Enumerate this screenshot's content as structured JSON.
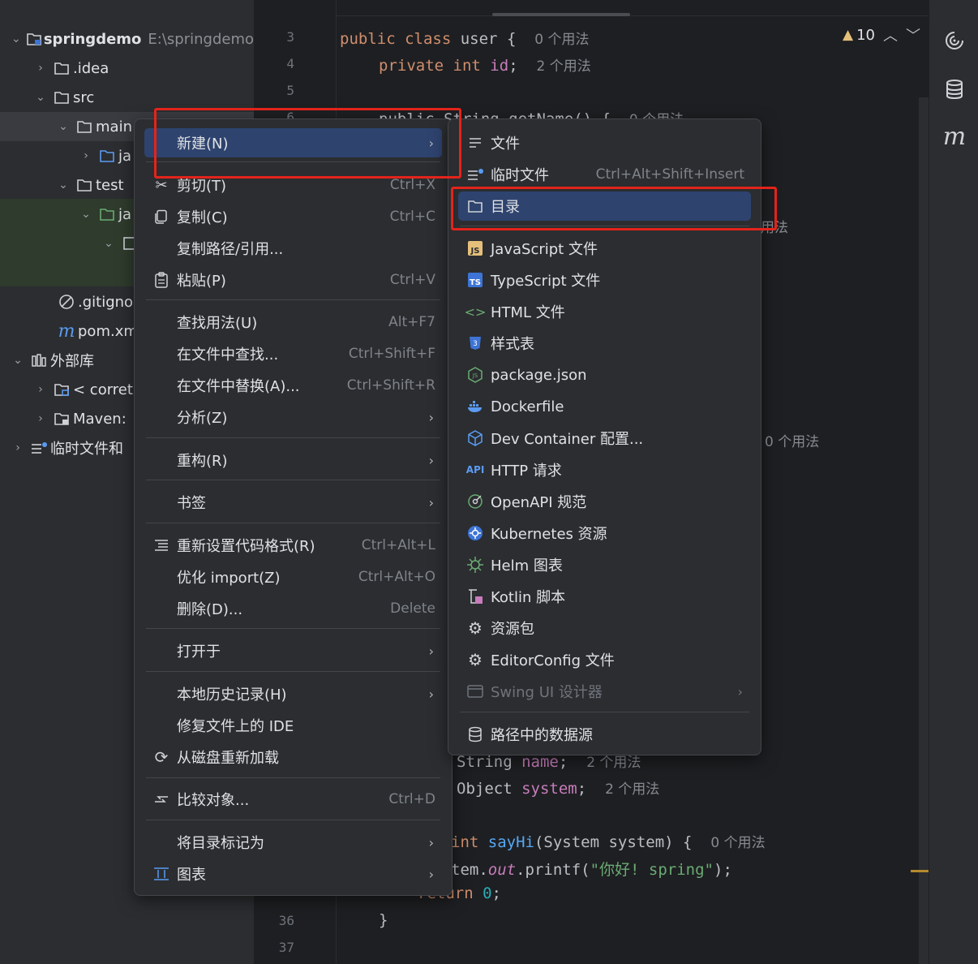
{
  "project_tree": {
    "root_name": "springdemo",
    "root_path": "E:\\springdemo",
    "items": [
      {
        "label": ".idea"
      },
      {
        "label": "src"
      },
      {
        "label": "main"
      },
      {
        "label": "ja"
      },
      {
        "label": "test"
      },
      {
        "label": "ja"
      },
      {
        "label": ""
      },
      {
        "label": ".gitigno"
      },
      {
        "label": "pom.xm"
      },
      {
        "label": "外部库"
      },
      {
        "label": "< corret"
      },
      {
        "label": "Maven:"
      },
      {
        "label": "临时文件和"
      }
    ]
  },
  "editor": {
    "line_numbers": [
      "3",
      "4",
      "5",
      "6",
      "36",
      "37"
    ],
    "line3": {
      "kw": "public class",
      "name": "user",
      "brace": "{",
      "hint": "0 个用法"
    },
    "line4": {
      "kw": "private int",
      "field": "id",
      "semi": ";",
      "hint": "2 个用法"
    },
    "line6": {
      "text": "public String getName() {",
      "hint": "0 个用法"
    },
    "partial_hint_1": "用法",
    "partial_hint_2": "0 个用法",
    "line_name": {
      "type": "String",
      "field": "name",
      "semi": ";",
      "hint": "2 个用法"
    },
    "line_system": {
      "type": "Object",
      "field": "system",
      "semi": ";",
      "hint": "2 个用法"
    },
    "line_sayhi": {
      "kw": "int",
      "fn": "sayHi",
      "params": "(System system) {",
      "hint": "0 个用法"
    },
    "line_printf": {
      "prefix": "tem.",
      "out": "out",
      "call": ".printf(",
      "str": "\"你好! spring\"",
      "end": ");"
    },
    "line_return": {
      "kw": "return",
      "num": "0",
      "semi": ";"
    },
    "line36": "}",
    "warnings": "10"
  },
  "context_menu": {
    "items": [
      {
        "label": "新建(N)",
        "shortcut": "",
        "icon": "",
        "arrow": true
      },
      {
        "label": "剪切(T)",
        "shortcut": "Ctrl+X",
        "icon": "scissors-icon"
      },
      {
        "label": "复制(C)",
        "shortcut": "Ctrl+C",
        "icon": "copy-icon"
      },
      {
        "label": "复制路径/引用...",
        "shortcut": "",
        "icon": ""
      },
      {
        "label": "粘贴(P)",
        "shortcut": "Ctrl+V",
        "icon": "paste-icon"
      },
      {
        "label": "查找用法(U)",
        "shortcut": "Alt+F7",
        "icon": ""
      },
      {
        "label": "在文件中查找...",
        "shortcut": "Ctrl+Shift+F",
        "icon": ""
      },
      {
        "label": "在文件中替换(A)...",
        "shortcut": "Ctrl+Shift+R",
        "icon": ""
      },
      {
        "label": "分析(Z)",
        "shortcut": "",
        "icon": "",
        "arrow": true
      },
      {
        "label": "重构(R)",
        "shortcut": "",
        "icon": "",
        "arrow": true
      },
      {
        "label": "书签",
        "shortcut": "",
        "icon": "",
        "arrow": true
      },
      {
        "label": "重新设置代码格式(R)",
        "shortcut": "Ctrl+Alt+L",
        "icon": "reformat-icon"
      },
      {
        "label": "优化 import(Z)",
        "shortcut": "Ctrl+Alt+O",
        "icon": ""
      },
      {
        "label": "删除(D)...",
        "shortcut": "Delete",
        "icon": ""
      },
      {
        "label": "打开于",
        "shortcut": "",
        "icon": "",
        "arrow": true
      },
      {
        "label": "本地历史记录(H)",
        "shortcut": "",
        "icon": "",
        "arrow": true
      },
      {
        "label": "修复文件上的 IDE",
        "shortcut": "",
        "icon": ""
      },
      {
        "label": "从磁盘重新加载",
        "shortcut": "",
        "icon": "reload-icon"
      },
      {
        "label": "比较对象...",
        "shortcut": "Ctrl+D",
        "icon": "compare-icon"
      },
      {
        "label": "将目录标记为",
        "shortcut": "",
        "icon": "",
        "arrow": true
      },
      {
        "label": "图表",
        "shortcut": "",
        "icon": "diagram-icon",
        "arrow": true
      }
    ]
  },
  "submenu": {
    "items": [
      {
        "label": "文件",
        "shortcut": ""
      },
      {
        "label": "临时文件",
        "shortcut": "Ctrl+Alt+Shift+Insert"
      },
      {
        "label": "目录",
        "shortcut": ""
      },
      {
        "label": "JavaScript 文件",
        "shortcut": "",
        "badge": "JS"
      },
      {
        "label": "TypeScript 文件",
        "shortcut": "",
        "badge": "TS"
      },
      {
        "label": "HTML 文件",
        "shortcut": ""
      },
      {
        "label": "样式表",
        "shortcut": ""
      },
      {
        "label": "package.json",
        "shortcut": ""
      },
      {
        "label": "Dockerfile",
        "shortcut": ""
      },
      {
        "label": "Dev Container 配置...",
        "shortcut": ""
      },
      {
        "label": "HTTP 请求",
        "shortcut": "",
        "badge": "API"
      },
      {
        "label": "OpenAPI 规范",
        "shortcut": ""
      },
      {
        "label": "Kubernetes 资源",
        "shortcut": ""
      },
      {
        "label": "Helm 图表",
        "shortcut": ""
      },
      {
        "label": "Kotlin 脚本",
        "shortcut": ""
      },
      {
        "label": "资源包",
        "shortcut": ""
      },
      {
        "label": "EditorConfig 文件",
        "shortcut": ""
      },
      {
        "label": "Swing UI 设计器",
        "shortcut": ""
      },
      {
        "label": "路径中的数据源",
        "shortcut": ""
      }
    ]
  },
  "colors": {
    "highlight": "#2e436e",
    "annotation_red": "#e3241b",
    "warning": "#e5c07b"
  }
}
